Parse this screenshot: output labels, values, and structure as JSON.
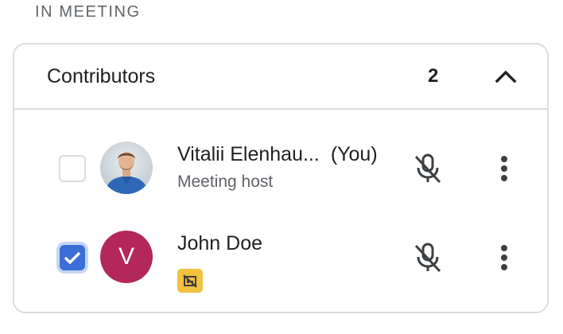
{
  "section": {
    "label": "IN MEETING"
  },
  "panel": {
    "title": "Contributors",
    "count": "2",
    "expanded": true
  },
  "participants": [
    {
      "name": "Vitalii Elenhau...",
      "you_label": "(You)",
      "subtitle": "Meeting host",
      "selected": false,
      "avatar_type": "photo",
      "mic_icon": "mic-off-icon",
      "menu_icon": "more-vert-icon"
    },
    {
      "name": "John Doe",
      "avatar_letter": "V",
      "avatar_color": "#b3275b",
      "selected": true,
      "tag_icon": "no-presentation-icon",
      "tag_color": "#f2c13d",
      "mic_icon": "mic-off-icon",
      "menu_icon": "more-vert-icon"
    }
  ],
  "colors": {
    "accent": "#3a6fd8",
    "border": "#dadce0",
    "text_primary": "#202124",
    "text_secondary": "#5f6368"
  }
}
